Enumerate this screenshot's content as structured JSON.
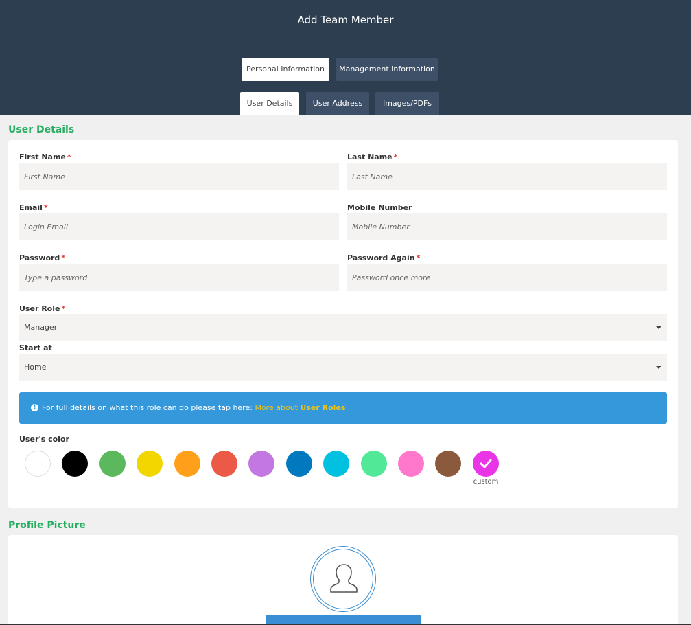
{
  "header": {
    "title": "Add Team Member",
    "tabs_primary": [
      {
        "label": "Personal Information",
        "active": true
      },
      {
        "label": "Management Information",
        "active": false
      }
    ],
    "tabs_secondary": [
      {
        "label": "User Details",
        "active": true
      },
      {
        "label": "User Address",
        "active": false
      },
      {
        "label": "Images/PDFs",
        "active": false
      }
    ]
  },
  "user_details": {
    "title": "User Details",
    "required_marker": "*",
    "first_name": {
      "label": "First Name",
      "placeholder": "First Name",
      "value": ""
    },
    "last_name": {
      "label": "Last Name",
      "placeholder": "Last Name",
      "value": ""
    },
    "email": {
      "label": "Email",
      "placeholder": "Login Email",
      "value": ""
    },
    "mobile": {
      "label": "Mobile Number",
      "placeholder": "Mobile Number",
      "value": ""
    },
    "password": {
      "label": "Password",
      "placeholder": "Type a password",
      "value": ""
    },
    "password_again": {
      "label": "Password Again",
      "placeholder": "Password once more",
      "value": ""
    },
    "user_role": {
      "label": "User Role",
      "value": "Manager"
    },
    "start_at": {
      "label": "Start at",
      "value": "Home"
    },
    "info": {
      "icon": "info-icon",
      "text": "For full details on what this role can do please tap here:",
      "link_prefix": "More about",
      "link_bold": "User Roles"
    },
    "color": {
      "label": "User's color",
      "swatches": [
        "#ffffff",
        "#000000",
        "#5cb85c",
        "#f2d600",
        "#ff9f1a",
        "#eb5a46",
        "#c377e0",
        "#0079bf",
        "#00c2e0",
        "#51e898",
        "#ff78cb",
        "#8b5a3c",
        "#e935e6"
      ],
      "custom_label": "custom",
      "selected": "custom"
    }
  },
  "profile_picture": {
    "title": "Profile Picture",
    "icon": "user-silhouette-icon"
  },
  "colors": {
    "header_bg": "#2e3e51",
    "section_title": "#27ae60",
    "info_bg": "#3498db",
    "link": "#f1c40f"
  }
}
